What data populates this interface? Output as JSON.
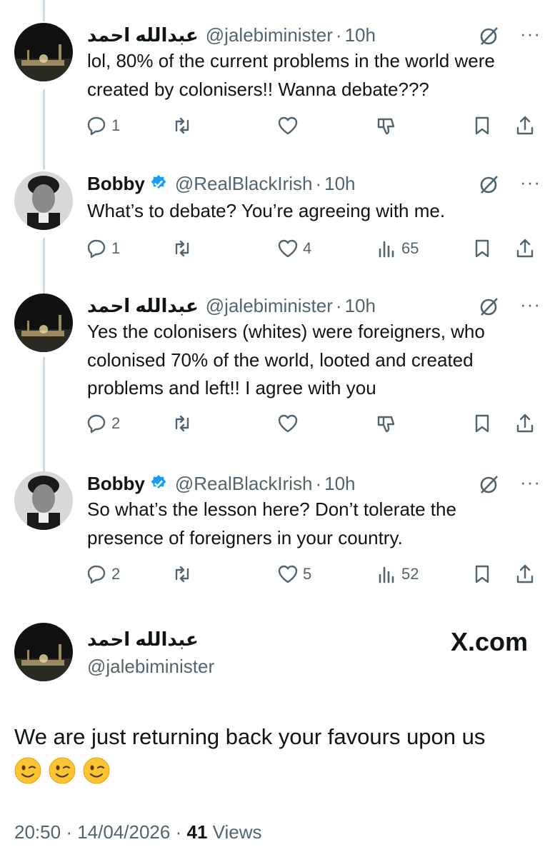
{
  "tweets": [
    {
      "name": "عبدالله احمد",
      "handle": "@jalebiminister",
      "time": "10h",
      "verified": false,
      "text": "lol, 80% of the current problems in the world were created by colonisers!! Wanna debate???",
      "replies": "1",
      "retweets": "",
      "likes": "",
      "views": "",
      "avatar": "night-mosque"
    },
    {
      "name": "Bobby",
      "handle": "@RealBlackIrish",
      "time": "10h",
      "verified": true,
      "text": "What’s to debate? You’re agreeing with me.",
      "replies": "1",
      "retweets": "",
      "likes": "4",
      "views": "65",
      "avatar": "bw-portrait"
    },
    {
      "name": "عبدالله احمد",
      "handle": "@jalebiminister",
      "time": "10h",
      "verified": false,
      "text": "Yes the colonisers (whites) were foreigners, who colonised 70% of the world, looted and created problems and left!! I agree with you",
      "replies": "2",
      "retweets": "",
      "likes": "",
      "views": "",
      "avatar": "night-mosque"
    },
    {
      "name": "Bobby",
      "handle": "@RealBlackIrish",
      "time": "10h",
      "verified": true,
      "text": "So what’s the lesson here? Don’t tolerate the presence of foreigners in your country.",
      "replies": "2",
      "retweets": "",
      "likes": "5",
      "views": "52",
      "avatar": "bw-portrait"
    }
  ],
  "main": {
    "name": "عبدالله احمد",
    "handle": "@jalebiminister",
    "site": "X.com",
    "text": "We are just returning back your favours upon us",
    "emojis": [
      "winking-face",
      "winking-face",
      "winking-face"
    ],
    "time": "20:50",
    "date": "14/04/2026",
    "views_count": "41",
    "views_label": "Views"
  },
  "separator": "·",
  "more_label": "···",
  "colors": {
    "text": "#0f1419",
    "muted": "#536471",
    "verified": "#1d9bf0",
    "thread_line": "#cfd9de"
  }
}
